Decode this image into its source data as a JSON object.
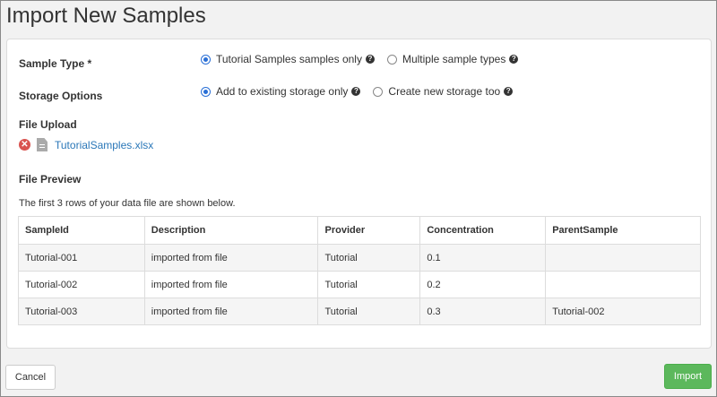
{
  "page_title": "Import New Samples",
  "sample_type": {
    "label": "Sample Type *",
    "options": [
      {
        "label": "Tutorial Samples samples only",
        "checked": true
      },
      {
        "label": "Multiple sample types",
        "checked": false
      }
    ]
  },
  "storage_options": {
    "label": "Storage Options",
    "options": [
      {
        "label": "Add to existing storage only",
        "checked": true
      },
      {
        "label": "Create new storage too",
        "checked": false
      }
    ]
  },
  "file_upload": {
    "label": "File Upload",
    "file_name": "TutorialSamples.xlsx"
  },
  "file_preview": {
    "label": "File Preview",
    "note": "The first 3 rows of your data file are shown below.",
    "columns": [
      "SampleId",
      "Description",
      "Provider",
      "Concentration",
      "ParentSample"
    ],
    "rows": [
      [
        "Tutorial-001",
        "imported from file",
        "Tutorial",
        "0.1",
        ""
      ],
      [
        "Tutorial-002",
        "imported from file",
        "Tutorial",
        "0.2",
        ""
      ],
      [
        "Tutorial-003",
        "imported from file",
        "Tutorial",
        "0.3",
        "Tutorial-002"
      ]
    ]
  },
  "buttons": {
    "cancel": "Cancel",
    "import": "Import"
  },
  "icons": {
    "help": "question-circle-icon",
    "remove": "remove-icon",
    "file": "file-icon"
  },
  "colors": {
    "accent": "#2a6fd6",
    "link": "#2a77b8",
    "danger": "#d9534f",
    "success": "#5cb85c"
  }
}
